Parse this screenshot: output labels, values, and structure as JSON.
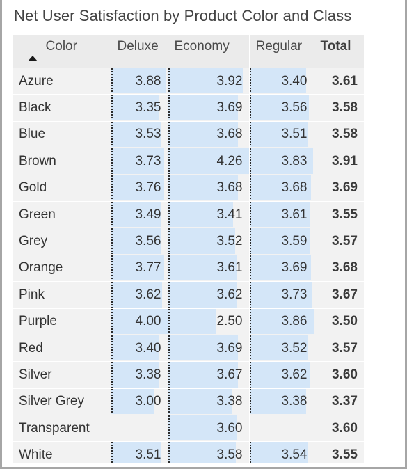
{
  "visual": {
    "title": "Net User Satisfaction by Product Color and Class",
    "sort_icon": "sort-ascending-triangle-icon",
    "sorted_column": "Color",
    "sort_direction": "ascending"
  },
  "colors": {
    "data_bar_fill": "#d4e6f8",
    "data_bar_axis": "#2b2b2b",
    "row_background": "#f2f2f2",
    "header_background": "#ebebeb",
    "gridline": "#ffffff",
    "text": "#333333",
    "title_text": "#444444",
    "frame_border": "#a6a6a6"
  },
  "table": {
    "columns": [
      {
        "key": "color",
        "label": "Color",
        "align": "left",
        "bold": false,
        "has_bars": false
      },
      {
        "key": "deluxe",
        "label": "Deluxe",
        "align": "right",
        "bold": false,
        "has_bars": true
      },
      {
        "key": "economy",
        "label": "Economy",
        "align": "right",
        "bold": false,
        "has_bars": true
      },
      {
        "key": "regular",
        "label": "Regular",
        "align": "right",
        "bold": false,
        "has_bars": true
      },
      {
        "key": "total",
        "label": "Total",
        "align": "right",
        "bold": true,
        "has_bars": false
      }
    ],
    "bar_axis_max": {
      "deluxe": 4.0,
      "economy": 4.26,
      "regular": 3.86
    },
    "rows": [
      {
        "color": "Azure",
        "deluxe": "3.88",
        "economy": "3.92",
        "regular": "3.40",
        "total": "3.61"
      },
      {
        "color": "Black",
        "deluxe": "3.35",
        "economy": "3.69",
        "regular": "3.56",
        "total": "3.58"
      },
      {
        "color": "Blue",
        "deluxe": "3.53",
        "economy": "3.68",
        "regular": "3.51",
        "total": "3.58"
      },
      {
        "color": "Brown",
        "deluxe": "3.73",
        "economy": "4.26",
        "regular": "3.83",
        "total": "3.91"
      },
      {
        "color": "Gold",
        "deluxe": "3.76",
        "economy": "3.68",
        "regular": "3.68",
        "total": "3.69"
      },
      {
        "color": "Green",
        "deluxe": "3.49",
        "economy": "3.41",
        "regular": "3.61",
        "total": "3.55"
      },
      {
        "color": "Grey",
        "deluxe": "3.56",
        "economy": "3.52",
        "regular": "3.59",
        "total": "3.57"
      },
      {
        "color": "Orange",
        "deluxe": "3.77",
        "economy": "3.61",
        "regular": "3.69",
        "total": "3.68"
      },
      {
        "color": "Pink",
        "deluxe": "3.62",
        "economy": "3.62",
        "regular": "3.73",
        "total": "3.67"
      },
      {
        "color": "Purple",
        "deluxe": "4.00",
        "economy": "2.50",
        "regular": "3.86",
        "total": "3.50"
      },
      {
        "color": "Red",
        "deluxe": "3.40",
        "economy": "3.69",
        "regular": "3.52",
        "total": "3.57"
      },
      {
        "color": "Silver",
        "deluxe": "3.38",
        "economy": "3.67",
        "regular": "3.62",
        "total": "3.60"
      },
      {
        "color": "Silver Grey",
        "deluxe": "3.00",
        "economy": "3.38",
        "regular": "3.38",
        "total": "3.37"
      },
      {
        "color": "Transparent",
        "deluxe": "",
        "economy": "3.60",
        "regular": "",
        "total": "3.60"
      },
      {
        "color": "White",
        "deluxe": "3.51",
        "economy": "3.58",
        "regular": "3.54",
        "total": "3.55"
      }
    ]
  },
  "chart_data": {
    "type": "table",
    "title": "Net User Satisfaction by Product Color and Class",
    "xlabel": "Class",
    "ylabel": "Color",
    "categories": [
      "Azure",
      "Black",
      "Blue",
      "Brown",
      "Gold",
      "Green",
      "Grey",
      "Orange",
      "Pink",
      "Purple",
      "Red",
      "Silver",
      "Silver Grey",
      "Transparent",
      "White"
    ],
    "series": [
      {
        "name": "Deluxe",
        "values": [
          3.88,
          3.35,
          3.53,
          3.73,
          3.76,
          3.49,
          3.56,
          3.77,
          3.62,
          4.0,
          3.4,
          3.38,
          3.0,
          null,
          3.51
        ]
      },
      {
        "name": "Economy",
        "values": [
          3.92,
          3.69,
          3.68,
          4.26,
          3.68,
          3.41,
          3.52,
          3.61,
          3.62,
          2.5,
          3.69,
          3.67,
          3.38,
          3.6,
          3.58
        ]
      },
      {
        "name": "Regular",
        "values": [
          3.4,
          3.56,
          3.51,
          3.83,
          3.68,
          3.61,
          3.59,
          3.69,
          3.73,
          3.86,
          3.52,
          3.62,
          3.38,
          null,
          3.54
        ]
      },
      {
        "name": "Total",
        "values": [
          3.61,
          3.58,
          3.58,
          3.91,
          3.69,
          3.55,
          3.57,
          3.68,
          3.67,
          3.5,
          3.57,
          3.6,
          3.37,
          3.6,
          3.55
        ]
      }
    ],
    "value_format": "0.00",
    "data_bars_on": [
      "Deluxe",
      "Economy",
      "Regular"
    ],
    "grid": true,
    "legend": "none"
  }
}
